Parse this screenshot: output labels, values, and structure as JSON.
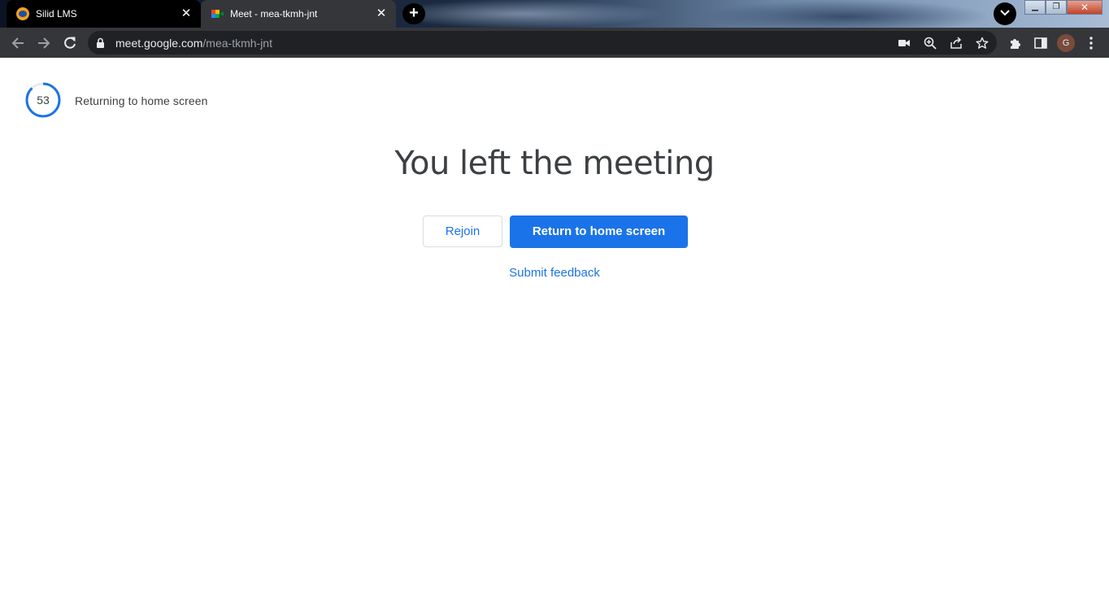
{
  "browser": {
    "tabs": [
      {
        "title": "Silid LMS",
        "favicon": "lms-icon",
        "active": false
      },
      {
        "title": "Meet - mea-tkmh-jnt",
        "favicon": "google-meet-icon",
        "active": true
      }
    ],
    "new_tab_label": "+",
    "address": {
      "host": "meet.google.com",
      "path": "/mea-tkmh-jnt"
    },
    "omnibox_icons": [
      "camera-icon",
      "zoom-icon",
      "share-icon",
      "star-icon"
    ],
    "toolbar_icons": [
      "extensions-icon",
      "side-panel-icon",
      "profile-avatar",
      "menu-icon"
    ],
    "profile_initial": "G"
  },
  "countdown": {
    "seconds": "53",
    "label": "Returning to home screen",
    "progress": 0.88,
    "color": "#1a73e8"
  },
  "main": {
    "headline": "You left the meeting",
    "rejoin_label": "Rejoin",
    "home_label": "Return to home screen",
    "feedback_label": "Submit feedback"
  },
  "colors": {
    "accent": "#1a73e8",
    "text": "#3c4043",
    "toolbar": "#35363a",
    "omnibox": "#202124"
  }
}
